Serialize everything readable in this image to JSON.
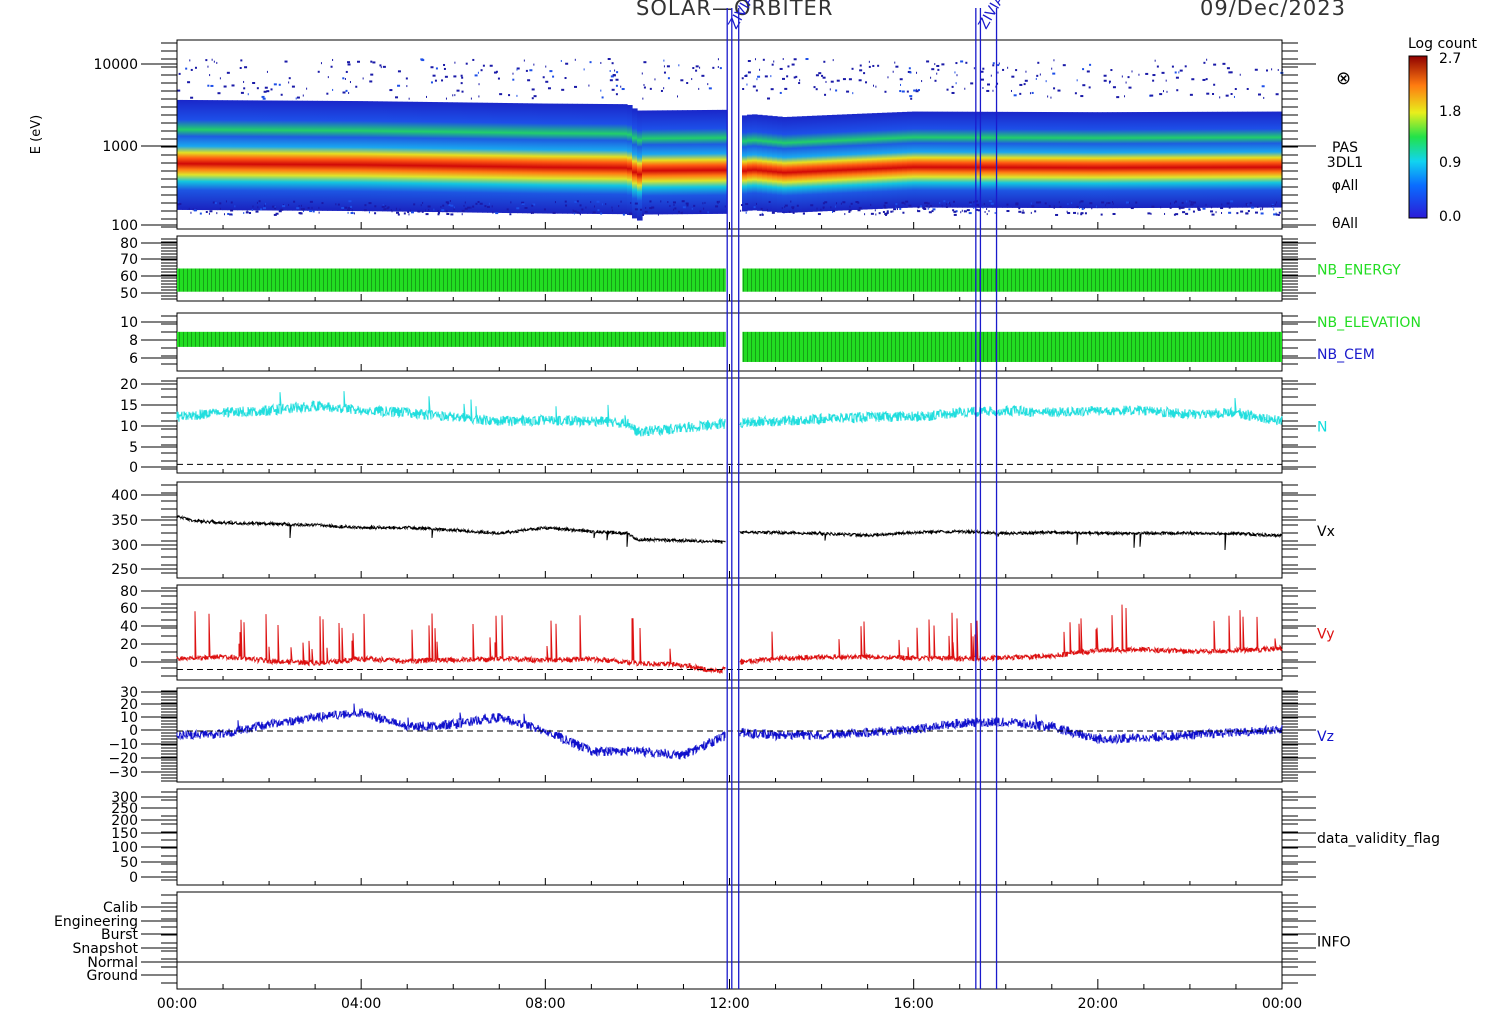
{
  "header": {
    "mission": "SOLAR—ORBITER",
    "date": "09/Dec/2023",
    "event_tags": [
      "ZIVIAL",
      "ZIVIAL"
    ]
  },
  "x_axis": {
    "tick_labels": [
      "00:00",
      "04:00",
      "08:00",
      "12:00",
      "16:00",
      "20:00",
      "00:00"
    ],
    "range_hours": [
      0,
      24
    ]
  },
  "colorbar": {
    "title": "Log count",
    "tick_labels": [
      "2.7",
      "1.8",
      "0.9",
      "0.0"
    ],
    "range": [
      0.0,
      2.7
    ]
  },
  "overlay_marker": "⊗",
  "vertical_markers_hours": [
    11.95,
    12.05,
    12.2,
    17.35,
    17.45,
    17.8
  ],
  "panels": [
    {
      "id": "spectrogram",
      "ylabel": "E (eV)",
      "scale": "log",
      "ylim": [
        100,
        20000
      ],
      "tick_labels": [
        "10000",
        "1000",
        "100"
      ],
      "labels": [
        {
          "text": "PAS",
          "color": "#000000"
        },
        {
          "text": "3DL1",
          "color": "#000000"
        },
        {
          "text": "φAll",
          "color": "#000000"
        },
        {
          "text": "θAll",
          "color": "#000000"
        }
      ]
    },
    {
      "id": "nb_energy",
      "tick_labels": [
        "80",
        "70",
        "60",
        "50"
      ],
      "ylim": [
        43,
        85
      ],
      "labels": [
        {
          "text": "NB_ENERGY",
          "color": "#22dd22"
        }
      ]
    },
    {
      "id": "nb_elev",
      "tick_labels": [
        "10",
        "8",
        "6"
      ],
      "ylim": [
        3.8,
        11.5
      ],
      "labels": [
        {
          "text": "NB_ELEVATION",
          "color": "#22dd22"
        },
        {
          "text": "NB_CEM",
          "color": "#1a1acc"
        }
      ]
    },
    {
      "id": "density",
      "tick_labels": [
        "20",
        "15",
        "10",
        "5",
        "0"
      ],
      "ylim": [
        -2,
        20
      ],
      "labels": [
        {
          "text": "N",
          "color": "#11dddd"
        }
      ]
    },
    {
      "id": "vx",
      "tick_labels": [
        "400",
        "350",
        "300",
        "250"
      ],
      "ylim": [
        225,
        425
      ],
      "labels": [
        {
          "text": "Vx",
          "color": "#000000"
        }
      ]
    },
    {
      "id": "vy",
      "tick_labels": [
        "80",
        "60",
        "40",
        "20",
        "0"
      ],
      "ylim": [
        -10,
        80
      ],
      "labels": [
        {
          "text": "Vy",
          "color": "#dd1111"
        }
      ]
    },
    {
      "id": "vz",
      "tick_labels": [
        "30",
        "20",
        "10",
        "0",
        "−10",
        "−20",
        "−30"
      ],
      "ylim": [
        -38,
        32
      ],
      "labels": [
        {
          "text": "Vz",
          "color": "#1111cc"
        }
      ]
    },
    {
      "id": "validity",
      "tick_labels": [
        "300",
        "250",
        "200",
        "150",
        "100",
        "50",
        "0"
      ],
      "ylim": [
        -25,
        310
      ],
      "labels": [
        {
          "text": "data_validity_flag",
          "color": "#000000"
        }
      ]
    },
    {
      "id": "info",
      "tick_labels": [
        "Calib",
        "Engineering",
        "Burst",
        "Snapshot",
        "Normal",
        "Ground"
      ],
      "labels": [
        {
          "text": "INFO",
          "color": "#000000"
        }
      ]
    }
  ],
  "chart_data": [
    {
      "type": "heatmap",
      "ylabel": "E (eV)",
      "y_scale": "log",
      "ylim": [
        100,
        20000
      ],
      "xlim": [
        0,
        24
      ],
      "description_series": [
        {
          "name": "",
          "x": [
            0,
            4,
            8,
            9.8,
            10,
            12,
            12.5,
            13.2,
            16,
            20,
            24
          ],
          "values": [
            620,
            600,
            560,
            550,
            460,
            470,
            520,
            480,
            560,
            550,
            560
          ]
        }
      ]
    },
    {
      "type": "bar",
      "ylim": [
        43,
        85
      ],
      "x": [
        0,
        24
      ],
      "values": [
        64,
        64
      ],
      "band_min": [
        49,
        49
      ]
    },
    {
      "type": "bar",
      "ylim": [
        3.8,
        11.5
      ],
      "x": [
        0,
        11.9,
        12.3,
        24
      ],
      "values": [
        9,
        9,
        9,
        9
      ],
      "band_min": [
        7,
        7,
        5,
        5
      ]
    },
    {
      "type": "line",
      "ylim": [
        -2,
        20
      ],
      "series": [
        {
          "name": "N",
          "x": [
            0,
            1,
            2,
            3,
            4,
            5,
            6,
            7,
            8,
            9,
            9.8,
            10,
            11,
            12,
            13,
            14,
            15,
            16,
            17,
            18,
            19,
            20,
            21,
            22,
            23,
            24
          ],
          "values": [
            11,
            12,
            12.5,
            13.5,
            12.5,
            12,
            11,
            10,
            10.2,
            10,
            9.5,
            7.5,
            8.5,
            9.5,
            10,
            10.5,
            11,
            11,
            12,
            12.5,
            12,
            12.5,
            12.5,
            11.5,
            12,
            10
          ]
        }
      ]
    },
    {
      "type": "line",
      "ylim": [
        225,
        425
      ],
      "series": [
        {
          "name": "Vx",
          "x": [
            0,
            0.3,
            1,
            2,
            3,
            4,
            5,
            6,
            7,
            8,
            9,
            9.8,
            10,
            11,
            12,
            12.2,
            13,
            14,
            15,
            16,
            17,
            18,
            19,
            20,
            21,
            22,
            23,
            24
          ],
          "values": [
            355,
            345,
            340,
            338,
            335,
            330,
            330,
            325,
            318,
            330,
            322,
            318,
            305,
            303,
            300,
            320,
            320,
            318,
            314,
            320,
            322,
            318,
            320,
            318,
            318,
            318,
            318,
            313
          ]
        }
      ]
    },
    {
      "type": "line",
      "ylim": [
        -10,
        80
      ],
      "series": [
        {
          "name": "Vy",
          "x": [
            0,
            1,
            2,
            3,
            4,
            5,
            6,
            7,
            8,
            9,
            10,
            11,
            11.8,
            12,
            13,
            14,
            15,
            16,
            17,
            18,
            19,
            20,
            21,
            22,
            23,
            24
          ],
          "values": [
            10,
            12,
            8,
            6,
            10,
            8,
            9,
            10,
            9,
            10,
            6,
            4,
            -2,
            6,
            10,
            12,
            12,
            11,
            10,
            11,
            13,
            18,
            19,
            17,
            18,
            20
          ]
        }
      ]
    },
    {
      "type": "line",
      "ylim": [
        -38,
        32
      ],
      "series": [
        {
          "name": "Vz",
          "x": [
            0,
            1,
            2,
            3,
            4,
            5,
            6,
            7,
            8,
            9,
            10,
            11,
            11.8,
            12.2,
            13,
            14,
            15,
            16,
            17,
            18,
            19,
            20,
            21,
            22,
            23,
            24
          ],
          "values": [
            -3,
            -2,
            5,
            10,
            14,
            3,
            5,
            10,
            0,
            -15,
            -15,
            -18,
            -5,
            -1,
            -3,
            -3,
            -1,
            1,
            6,
            7,
            3,
            -6,
            -5,
            -3,
            -1,
            1
          ]
        }
      ]
    },
    {
      "type": "line",
      "ylim": [
        -25,
        310
      ],
      "series": []
    },
    {
      "type": "line",
      "categories": [
        "Calib",
        "Engineering",
        "Burst",
        "Snapshot",
        "Normal",
        "Ground"
      ],
      "series": [
        {
          "name": "INFO",
          "x": [
            0,
            24
          ],
          "values": [
            "Normal",
            "Normal"
          ]
        }
      ]
    }
  ]
}
